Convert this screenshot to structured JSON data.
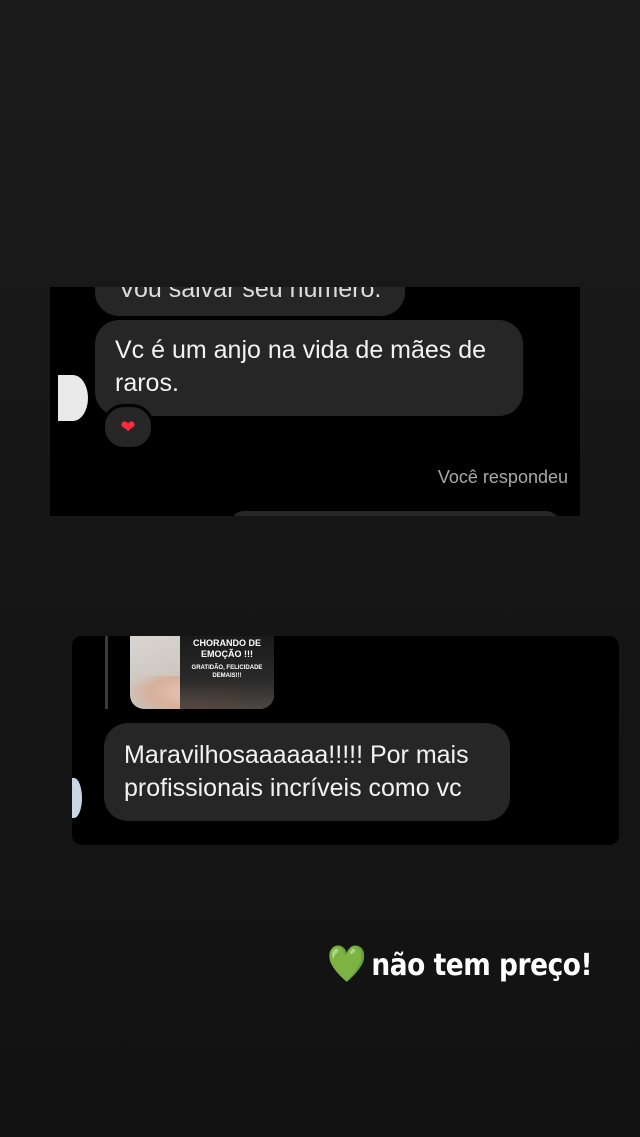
{
  "chat_top": {
    "cut_message": "Vou salvar seu número.",
    "message": "Vc é um anjo na vida de mães de raros.",
    "reaction_icon": "red-heart-emoji",
    "reaction": "❤",
    "meta": "Você respondeu"
  },
  "chat_bottom": {
    "thumbnail": {
      "headline": "CHORANDO DE EMOÇÃO !!!",
      "subtext": "GRATIDÃO, FELICIDADE DEMAIS!!!"
    },
    "message": "Maravilhosaaaaaa!!!!! Por mais profissionais incríveis como vc"
  },
  "caption": {
    "icon": "green-heart-emoji",
    "emoji": "💚",
    "text": "não tem preço!"
  }
}
